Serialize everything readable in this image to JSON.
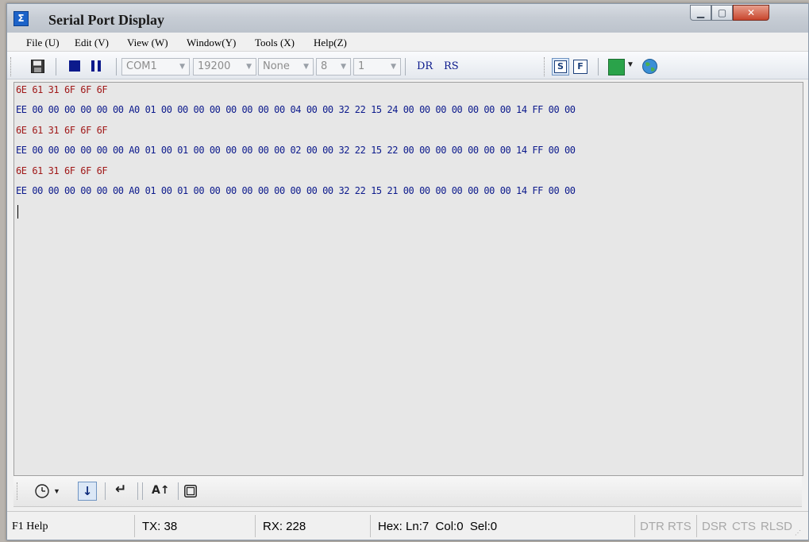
{
  "window": {
    "title": "Serial Port Display"
  },
  "menu": [
    "File (U)",
    "Edit (V)",
    "View (W)",
    "Window(Y)",
    "Tools (X)",
    "Help(Z)"
  ],
  "toolbar": {
    "port": "COM1",
    "baud": "19200",
    "parity": "None",
    "databits": "8",
    "stopbits": "1",
    "dr_label": "DR",
    "rs_label": "RS",
    "s_toggle": "S",
    "f_toggle": "F",
    "accent_green": "#2aa34a"
  },
  "terminal": {
    "lines": [
      {
        "kind": "sent",
        "text": "6E 61 31 6F 6F 6F"
      },
      {
        "kind": "recv",
        "text": "EE 00 00 00 00 00 00 A0 01 00 00 00 00 00 00 00 00 04 00 00 32 22 15 24 00 00 00 00 00 00 00 14 FF 00 00"
      },
      {
        "kind": "sent",
        "text": "6E 61 31 6F 6F 6F"
      },
      {
        "kind": "recv",
        "text": "EE 00 00 00 00 00 00 A0 01 00 01 00 00 00 00 00 00 02 00 00 32 22 15 22 00 00 00 00 00 00 00 14 FF 00 00"
      },
      {
        "kind": "sent",
        "text": "6E 61 31 6F 6F 6F"
      },
      {
        "kind": "recv",
        "text": "EE 00 00 00 00 00 00 A0 01 00 01 00 00 00 00 00 00 00 00 00 32 22 15 21 00 00 00 00 00 00 00 14 FF 00 00"
      }
    ],
    "sent_color": "#a01818",
    "recv_color": "#0c1a8c"
  },
  "bottombar": {
    "font_size_icon": "A↑"
  },
  "statusbar": {
    "help": "F1 Help",
    "tx": "TX: 38",
    "rx": "RX: 228",
    "position": "Hex: Ln:7  Col:0  Sel:0",
    "dtr": "DTR",
    "rts": "RTS",
    "dsr": "DSR",
    "cts": "CTS",
    "rlsd": "RLSD"
  }
}
